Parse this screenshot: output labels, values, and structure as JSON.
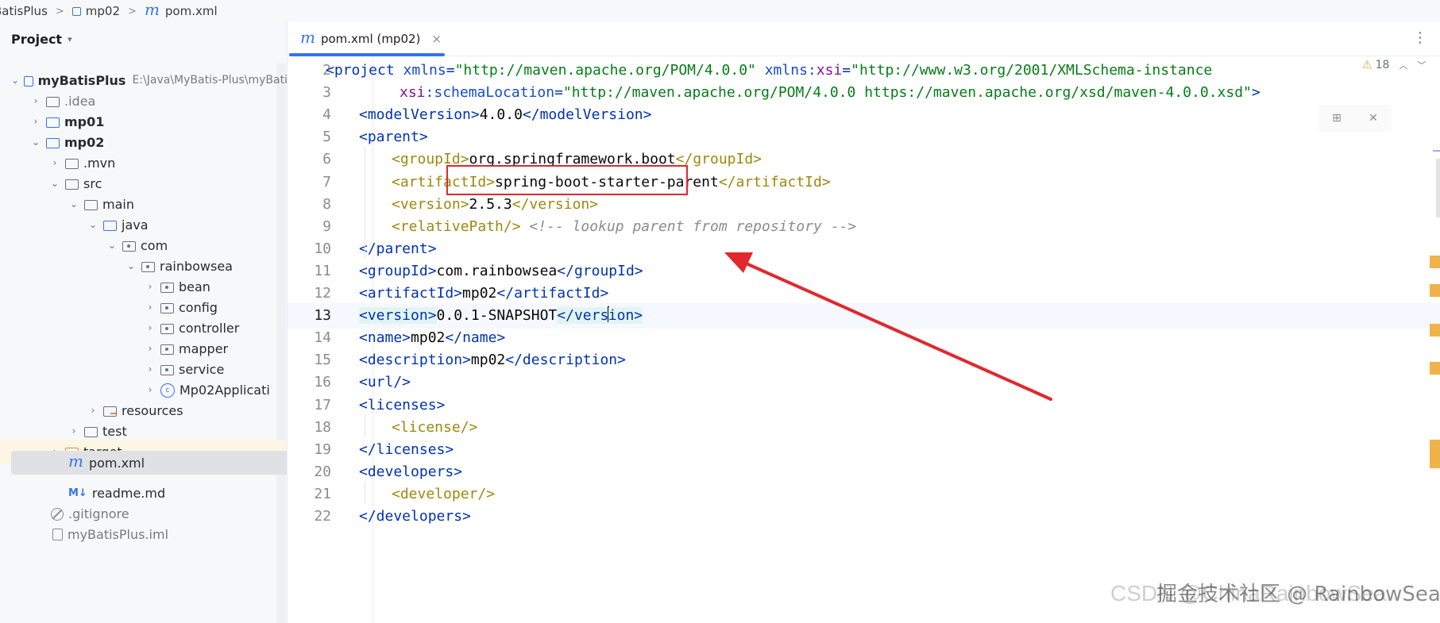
{
  "breadcrumb": {
    "items": [
      "BatisPlus",
      "mp02",
      "pom.xml"
    ]
  },
  "project_panel": {
    "title": "Project",
    "tree": [
      {
        "label": "myBatisPlus",
        "path": "E:\\Java\\MyBatis-Plus\\myBati"
      },
      {
        "label": ".idea"
      },
      {
        "label": "mp01"
      },
      {
        "label": "mp02"
      },
      {
        "label": ".mvn"
      },
      {
        "label": "src"
      },
      {
        "label": "main"
      },
      {
        "label": "java"
      },
      {
        "label": "com"
      },
      {
        "label": "rainbowsea"
      },
      {
        "label": "bean"
      },
      {
        "label": "config"
      },
      {
        "label": "controller"
      },
      {
        "label": "mapper"
      },
      {
        "label": "service"
      },
      {
        "label": "Mp02Applicati"
      },
      {
        "label": "resources"
      },
      {
        "label": "test"
      },
      {
        "label": "target"
      },
      {
        "label": "pom.xml"
      },
      {
        "label": "readme.md"
      },
      {
        "label": ".gitignore"
      },
      {
        "label": "myBatisPlus.iml"
      }
    ]
  },
  "editor": {
    "tab_label": "pom.xml (mp02)",
    "tab_close": "×",
    "menu_glyph": "⋮",
    "warning_count": "18",
    "current_line": 13,
    "lines": [
      {
        "n": "2",
        "parts": [
          [
            "tag",
            "<project "
          ],
          [
            "attr",
            "xmlns"
          ],
          [
            "tag",
            "="
          ],
          [
            "val",
            "\"http://maven.apache.org/POM/4.0.0\""
          ],
          [
            "tag",
            " "
          ],
          [
            "attr",
            "xmlns:"
          ],
          [
            "ns",
            "xsi"
          ],
          [
            "tag",
            "="
          ],
          [
            "val",
            "\"http://www.w3.org/2001/XMLSchema-instance"
          ]
        ]
      },
      {
        "n": "3",
        "parts": [
          [
            "ns",
            "xsi"
          ],
          [
            "attr",
            ":schemaLocation"
          ],
          [
            "tag",
            "="
          ],
          [
            "val",
            "\"http://maven.apache.org/POM/4.0.0 https://maven.apache.org/xsd/maven-4.0.0.xsd\""
          ],
          [
            "tag",
            ">"
          ]
        ]
      },
      {
        "n": "4",
        "parts": [
          [
            "tag",
            "<modelVersion>"
          ],
          [
            "text",
            "4.0.0"
          ],
          [
            "tag",
            "</modelVersion>"
          ]
        ]
      },
      {
        "n": "5",
        "parts": [
          [
            "tag",
            "<parent>"
          ]
        ]
      },
      {
        "n": "6",
        "parts": [
          [
            "tag2",
            "<groupId>"
          ],
          [
            "text",
            "org.springframework.boot"
          ],
          [
            "tag2",
            "</groupId>"
          ]
        ]
      },
      {
        "n": "7",
        "parts": [
          [
            "tag2",
            "<artifactId>"
          ],
          [
            "text",
            "spring-boot-starter-parent"
          ],
          [
            "tag2",
            "</artifactId>"
          ]
        ]
      },
      {
        "n": "8",
        "parts": [
          [
            "tag2",
            "<version>"
          ],
          [
            "text",
            "2.5.3"
          ],
          [
            "tag2",
            "</version>"
          ]
        ]
      },
      {
        "n": "9",
        "parts": [
          [
            "tag2",
            "<relativePath/>"
          ],
          [
            "text",
            " "
          ],
          [
            "comment",
            "<!-- lookup parent from repository -->"
          ]
        ]
      },
      {
        "n": "10",
        "parts": [
          [
            "tag",
            "</parent>"
          ]
        ]
      },
      {
        "n": "11",
        "parts": [
          [
            "tag",
            "<groupId>"
          ],
          [
            "text",
            "com.rainbowsea"
          ],
          [
            "tag",
            "</groupId>"
          ]
        ]
      },
      {
        "n": "12",
        "parts": [
          [
            "tag",
            "<artifactId>"
          ],
          [
            "text",
            "mp02"
          ],
          [
            "tag",
            "</artifactId>"
          ]
        ]
      },
      {
        "n": "13",
        "parts": [
          [
            "taghl",
            "<version>"
          ],
          [
            "text",
            "0.0.1-SNAPSHOT"
          ],
          [
            "taghl",
            "</vers"
          ],
          [
            "caret",
            ""
          ],
          [
            "taghl",
            "ion>"
          ]
        ]
      },
      {
        "n": "14",
        "parts": [
          [
            "tag",
            "<name>"
          ],
          [
            "text",
            "mp02"
          ],
          [
            "tag",
            "</name>"
          ]
        ]
      },
      {
        "n": "15",
        "parts": [
          [
            "tag",
            "<description>"
          ],
          [
            "text",
            "mp02"
          ],
          [
            "tag",
            "</description>"
          ]
        ]
      },
      {
        "n": "16",
        "parts": [
          [
            "tag",
            "<url/>"
          ]
        ]
      },
      {
        "n": "17",
        "parts": [
          [
            "tag",
            "<licenses>"
          ]
        ]
      },
      {
        "n": "18",
        "parts": [
          [
            "tag2",
            "<license/>"
          ]
        ]
      },
      {
        "n": "19",
        "parts": [
          [
            "tag",
            "</licenses>"
          ]
        ]
      },
      {
        "n": "20",
        "parts": [
          [
            "tag",
            "<developers>"
          ]
        ]
      },
      {
        "n": "21",
        "parts": [
          [
            "tag2",
            "<developer/>"
          ]
        ]
      },
      {
        "n": "22",
        "parts": [
          [
            "tag",
            "</developers>"
          ]
        ]
      }
    ]
  },
  "watermark": "CSDN @ChinaRainbowSea",
  "watermark_overlay": "掘金技术社区 @ RainbowSea",
  "colors": {
    "accent": "#3574f0",
    "annotation_red": "#e0282e",
    "tag": "#0033b3",
    "nested_tag": "#9e880d",
    "string": "#067d17"
  }
}
